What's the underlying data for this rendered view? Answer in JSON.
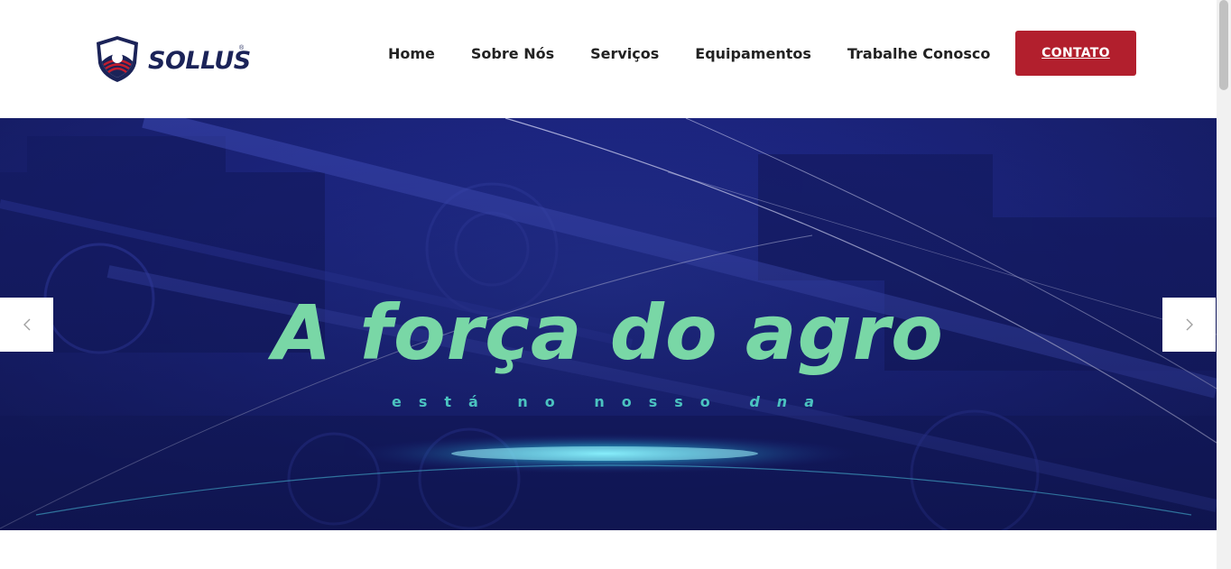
{
  "brand": {
    "name": "SOLLUS",
    "reg_mark": "®"
  },
  "nav": {
    "items": [
      {
        "label": "Home"
      },
      {
        "label": "Sobre Nós"
      },
      {
        "label": "Serviços"
      },
      {
        "label": "Equipamentos"
      },
      {
        "label": "Trabalhe Conosco"
      }
    ]
  },
  "cta": {
    "label": "CONTATO",
    "color": "#b21f2d"
  },
  "hero": {
    "title": "A força do agro",
    "subtitle_prefix": "está no nosso",
    "subtitle_emphasis": "dna",
    "title_color": "#79d7a6",
    "subtitle_color": "#4bc3c0",
    "background_color": "#1c2580",
    "prev_icon": "chevron-left-icon",
    "next_icon": "chevron-right-icon"
  }
}
